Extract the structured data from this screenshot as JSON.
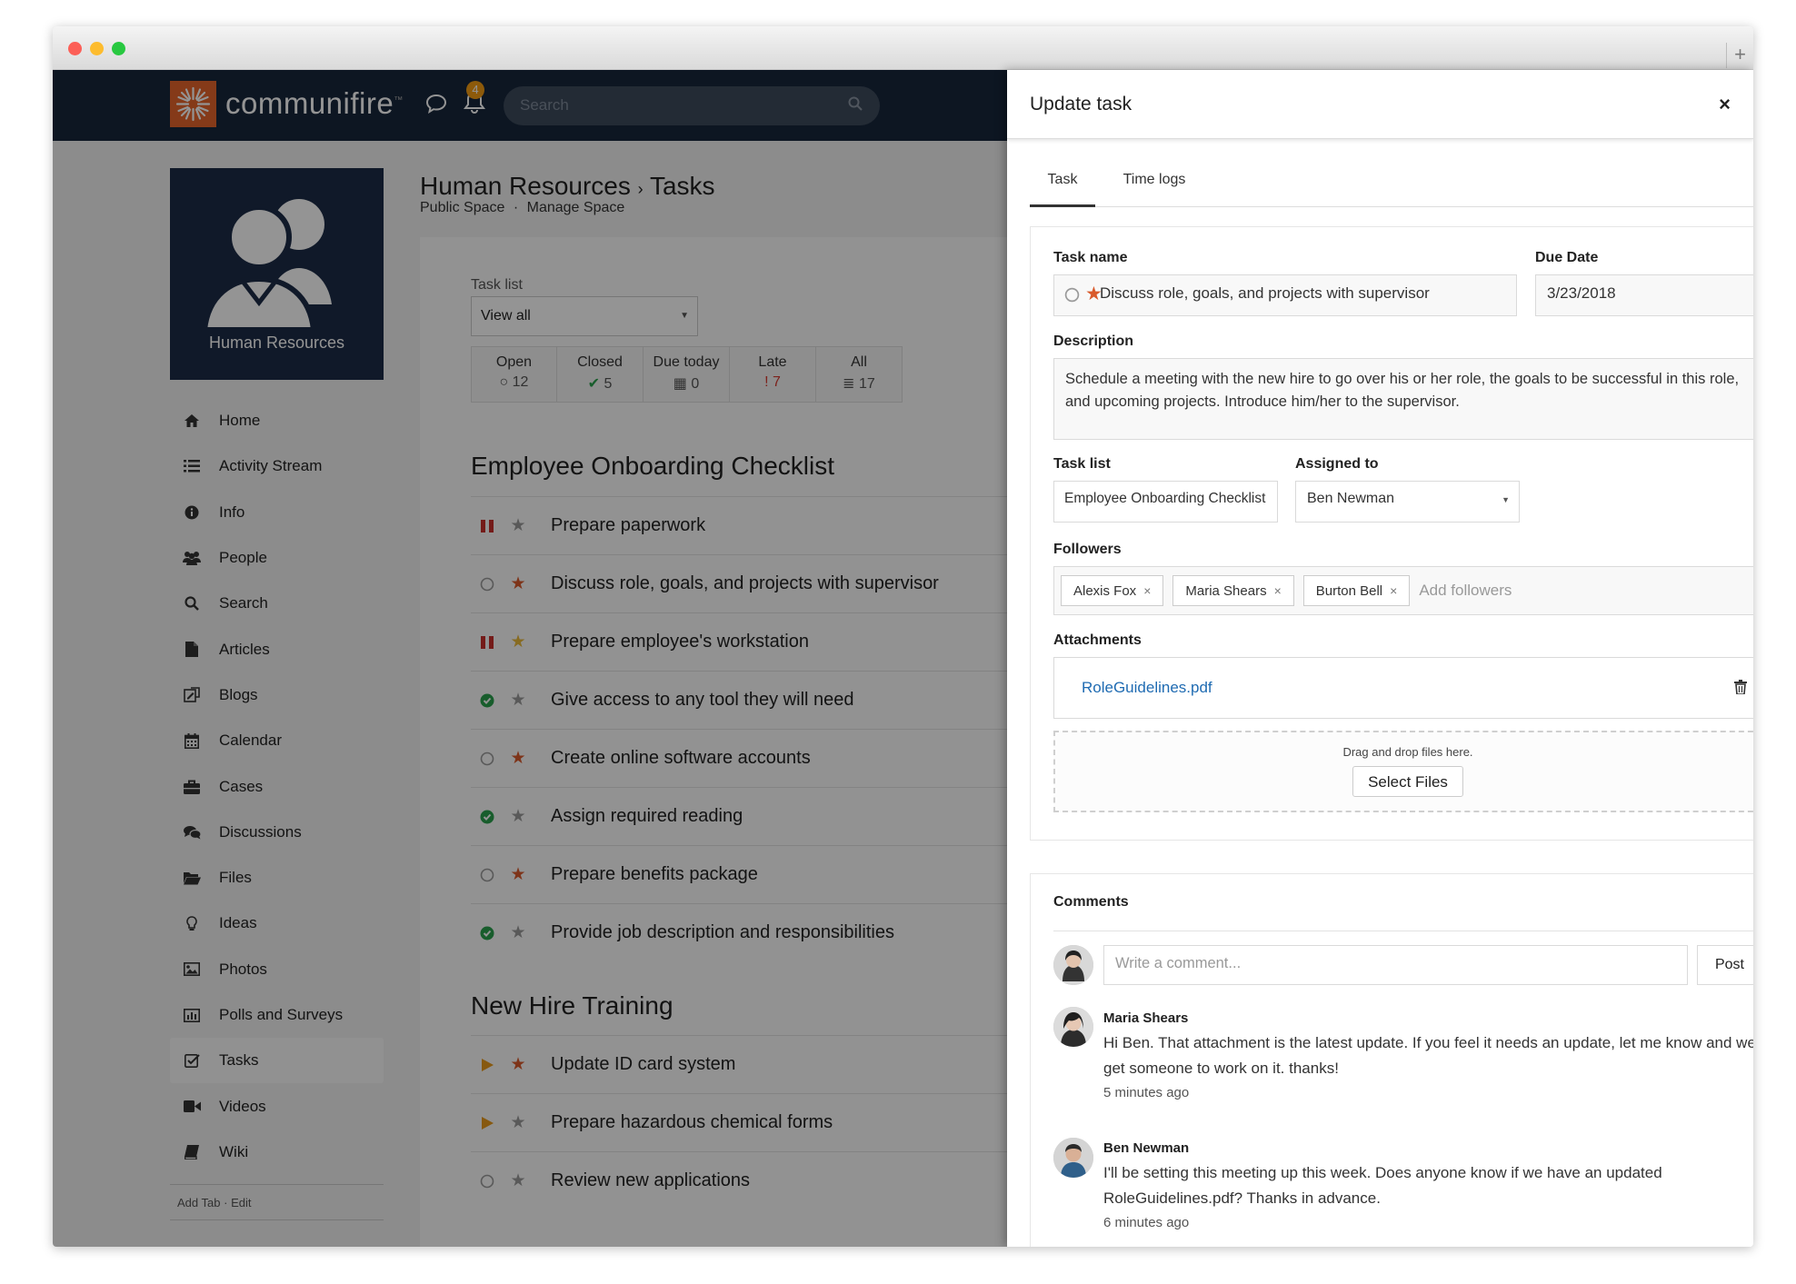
{
  "browser": {
    "new_tab_label": "+"
  },
  "navbar": {
    "logo_text": "communifire",
    "logo_tm": "™",
    "notification_count": "4",
    "search_placeholder": "Search"
  },
  "space": {
    "card_label": "Human Resources",
    "title_space": "Human Resources",
    "title_separator": "›",
    "title_page": "Tasks",
    "sub_public": "Public Space",
    "sub_separator": "·",
    "sub_manage": "Manage Space"
  },
  "sidebar": {
    "items": [
      {
        "label": "Home",
        "icon": "home-icon"
      },
      {
        "label": "Activity Stream",
        "icon": "list-icon"
      },
      {
        "label": "Info",
        "icon": "info-icon"
      },
      {
        "label": "People",
        "icon": "people-icon"
      },
      {
        "label": "Search",
        "icon": "search-icon"
      },
      {
        "label": "Articles",
        "icon": "document-icon"
      },
      {
        "label": "Blogs",
        "icon": "blog-icon"
      },
      {
        "label": "Calendar",
        "icon": "calendar-icon"
      },
      {
        "label": "Cases",
        "icon": "briefcase-icon"
      },
      {
        "label": "Discussions",
        "icon": "chat-icon"
      },
      {
        "label": "Files",
        "icon": "folder-icon"
      },
      {
        "label": "Ideas",
        "icon": "lightbulb-icon"
      },
      {
        "label": "Photos",
        "icon": "image-icon"
      },
      {
        "label": "Polls and Surveys",
        "icon": "bar-chart-icon"
      },
      {
        "label": "Tasks",
        "icon": "checkbox-icon"
      },
      {
        "label": "Videos",
        "icon": "video-icon"
      },
      {
        "label": "Wiki",
        "icon": "book-icon"
      }
    ],
    "footer_add_tab": "Add Tab",
    "footer_separator": "·",
    "footer_edit": "Edit"
  },
  "task_list": {
    "label": "Task list",
    "selected": "View all",
    "stats": [
      {
        "label": "Open",
        "glyph": "○",
        "value": "12"
      },
      {
        "label": "Closed",
        "glyph": "✔",
        "value": "5"
      },
      {
        "label": "Due today",
        "glyph": "▦",
        "value": "0"
      },
      {
        "label": "Late",
        "glyph": "!",
        "value": "7"
      },
      {
        "label": "All",
        "glyph": "≣",
        "value": "17"
      }
    ]
  },
  "groups": [
    {
      "title": "Employee Onboarding Checklist",
      "tasks": [
        {
          "label": "Prepare paperwork",
          "status": "paused",
          "star": "empty"
        },
        {
          "label": "Discuss role, goals, and projects with supervisor",
          "status": "open",
          "star": "orange"
        },
        {
          "label": "Prepare employee's workstation",
          "status": "paused",
          "star": "yellow"
        },
        {
          "label": "Give access to any tool they will need",
          "status": "done",
          "star": "empty"
        },
        {
          "label": "Create online software accounts",
          "status": "open",
          "star": "orange"
        },
        {
          "label": "Assign required reading",
          "status": "done",
          "star": "empty"
        },
        {
          "label": "Prepare benefits package",
          "status": "open",
          "star": "orange"
        },
        {
          "label": "Provide job description and responsibilities",
          "status": "done",
          "star": "empty"
        }
      ]
    },
    {
      "title": "New Hire Training",
      "tasks": [
        {
          "label": "Update ID card system",
          "status": "in-progress",
          "star": "orange"
        },
        {
          "label": "Prepare hazardous chemical forms",
          "status": "in-progress",
          "star": "empty"
        },
        {
          "label": "Review new applications",
          "status": "open",
          "star": "empty"
        }
      ]
    }
  ],
  "panel": {
    "title": "Update task",
    "close": "×",
    "tabs": [
      {
        "label": "Task",
        "active": true
      },
      {
        "label": "Time logs",
        "active": false
      }
    ],
    "form": {
      "task_name_label": "Task name",
      "task_name_value": "Discuss role, goals, and projects with supervisor",
      "due_date_label": "Due Date",
      "due_date_value": "3/23/2018",
      "description_label": "Description",
      "description_value": "Schedule a meeting with the new hire to go over his or her role, the goals to be successful in this role, and upcoming projects. Introduce him/her to the supervisor.",
      "task_list_label": "Task list",
      "task_list_value": "Employee Onboarding Checklist",
      "assigned_label": "Assigned to",
      "assigned_value": "Ben Newman",
      "followers_label": "Followers",
      "followers": [
        "Alexis Fox",
        "Maria Shears",
        "Burton Bell"
      ],
      "followers_placeholder": "Add followers",
      "attachments_label": "Attachments",
      "attachment_file": "RoleGuidelines.pdf",
      "dropzone_text": "Drag and drop files here.",
      "select_files": "Select Files"
    },
    "comments": {
      "label": "Comments",
      "placeholder": "Write a comment...",
      "post": "Post",
      "items": [
        {
          "author": "Maria Shears",
          "text": "Hi Ben. That attachment is the latest update. If you feel it needs an update, let me know and we'll get someone to work on it. thanks!",
          "time": "5 minutes ago"
        },
        {
          "author": "Ben Newman",
          "text": "I'll be setting this meeting up this week. Does anyone know if we have an updated RoleGuidelines.pdf? Thanks in advance.",
          "time": "6 minutes ago"
        }
      ]
    }
  },
  "colors": {
    "navbar": "#17263c",
    "brand": "#e5642b",
    "star_orange": "#d95a2b",
    "star_yellow": "#e8b83a",
    "done_green": "#2aa14d",
    "pause_red": "#c9302c",
    "link_blue": "#1f6bb2"
  }
}
